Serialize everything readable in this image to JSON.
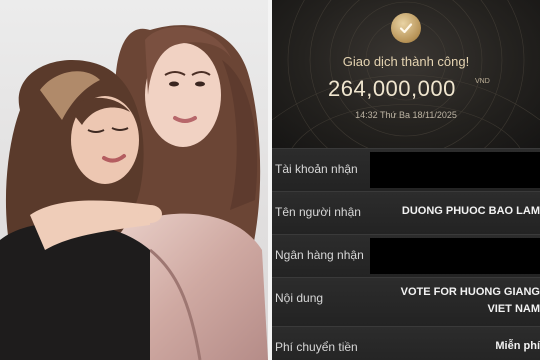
{
  "receipt": {
    "status_text": "Giao dịch thành công!",
    "amount": "264,000,000",
    "currency": "VND",
    "datetime": "14:32 Thứ Ba 18/11/2025",
    "rows": [
      {
        "label": "Tài khoản nhận",
        "value": "",
        "redacted": true
      },
      {
        "label": "Tên người nhận",
        "value": "DUONG PHUOC BAO LAM"
      },
      {
        "label": "Ngân hàng nhận",
        "value": "",
        "redacted": true
      },
      {
        "label": "Nội dung",
        "value": "VOTE FOR HUONG GIANG",
        "value_line2": "VIET NAM"
      },
      {
        "label": "Phí chuyển tiền",
        "value": "Miễn phí"
      }
    ]
  },
  "colors": {
    "gold": "#c9a66b",
    "receipt_bg": "#1f1f1f",
    "photo_bg": "#e7e4e4"
  },
  "icons": [
    "check-icon"
  ]
}
